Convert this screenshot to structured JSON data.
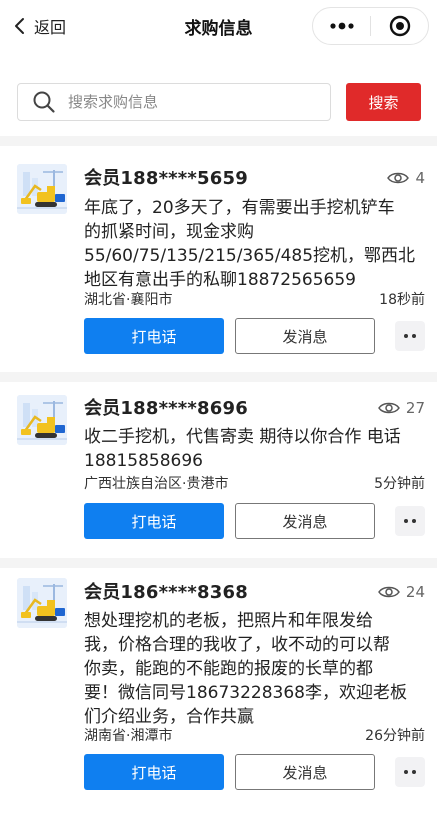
{
  "nav": {
    "back_label": "返回",
    "title": "求购信息"
  },
  "search": {
    "placeholder": "搜索求购信息",
    "button_label": "搜索"
  },
  "colors": {
    "search_button": "#e02a2a",
    "call_button": "#0f7ff0"
  },
  "listings": [
    {
      "member": "会员188****5659",
      "views": "4",
      "content_lines": [
        "年底了，20多天了，有需要出手挖机铲车",
        "的抓紧时间，现金求购",
        "55/60/75/135/215/365/485挖机，鄂西北",
        "地区有意出手的私聊18872565659"
      ],
      "region": "湖北省·襄阳市",
      "time": "18秒前",
      "call_label": "打电话",
      "message_label": "发消息"
    },
    {
      "member": "会员188****8696",
      "views": "27",
      "content_lines": [
        "收二手挖机，代售寄卖 期待以你合作 电话",
        "18815858696"
      ],
      "region": "广西壮族自治区·贵港市",
      "time": "5分钟前",
      "call_label": "打电话",
      "message_label": "发消息"
    },
    {
      "member": "会员186****8368",
      "views": "24",
      "content_lines": [
        "想处理挖机的老板，把照片和年限发给",
        "我，价格合理的我收了，收不动的可以帮",
        "你卖，能跑的不能跑的报废的长草的都",
        "要！微信同号18673228368李，欢迎老板",
        "们介绍业务，合作共赢"
      ],
      "region": "湖南省·湘潭市",
      "time": "26分钟前",
      "call_label": "打电话",
      "message_label": "发消息"
    }
  ]
}
